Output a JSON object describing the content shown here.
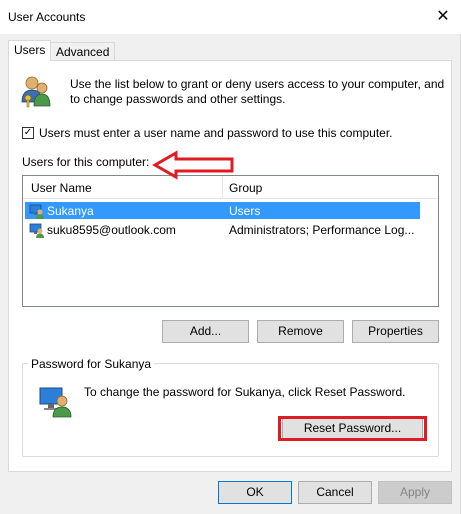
{
  "window": {
    "title": "User Accounts"
  },
  "tabs": [
    {
      "label": "Users"
    },
    {
      "label": "Advanced"
    }
  ],
  "intro": {
    "text": "Use the list below to grant or deny users access to your computer, and to change passwords and other settings."
  },
  "require_login": {
    "label": "Users must enter a user name and password to use this computer.",
    "checked": true
  },
  "users_section": {
    "label": "Users for this computer:"
  },
  "users_list": {
    "columns": [
      "User Name",
      "Group"
    ],
    "rows": [
      {
        "name": "Sukanya",
        "group": "Users",
        "selected": true
      },
      {
        "name": "suku8595@outlook.com",
        "group": "Administrators; Performance Log...",
        "selected": false
      }
    ]
  },
  "list_buttons": {
    "add": "Add...",
    "remove": "Remove",
    "properties": "Properties"
  },
  "password_group": {
    "label": "Password for Sukanya",
    "text": "To change the password for Sukanya, click Reset Password.",
    "reset_button": "Reset Password..."
  },
  "footer": {
    "ok": "OK",
    "cancel": "Cancel",
    "apply": "Apply"
  },
  "colors": {
    "selection": "#3399ff",
    "highlight": "#e01b24",
    "default_button_border": "#0078d7"
  },
  "icons": {
    "intro": "users-keys-icon",
    "row_user": "user-monitor-icon",
    "password": "user-monitor-icon",
    "close": "close-icon"
  }
}
